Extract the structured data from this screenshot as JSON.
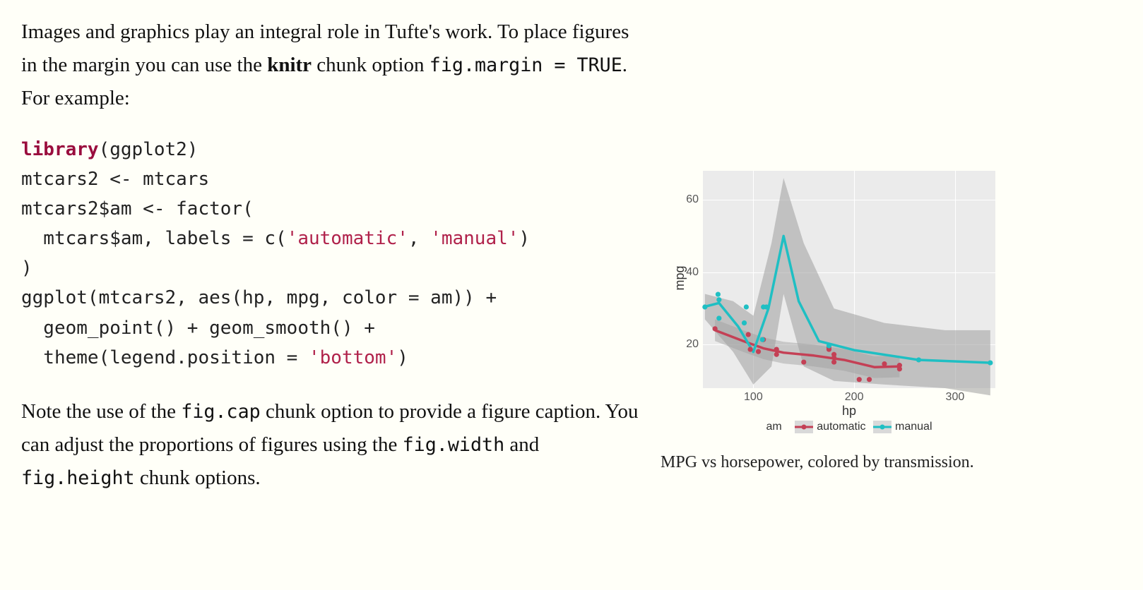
{
  "body": {
    "para1_a": "Images and graphics play an integral role in Tufte's work. To place figures in the margin you can use the ",
    "para1_strong": "knitr",
    "para1_b": " chunk option ",
    "para1_code": "fig.margin = TRUE",
    "para1_c": ". For example:",
    "para2_a": "Note the use of the ",
    "para2_code1": "fig.cap",
    "para2_b": " chunk option to provide a figure caption. You can adjust the proportions of figures using the ",
    "para2_code2": "fig.width",
    "para2_c": " and ",
    "para2_code3": "fig.height",
    "para2_d": " chunk options."
  },
  "code": {
    "kw_library": "library",
    "l1_rest": "(ggplot2)",
    "l2": "mtcars2 <- mtcars",
    "l3": "mtcars2$am <- factor(",
    "l4a": "  mtcars$am, labels = c(",
    "l4s1": "'automatic'",
    "l4b": ", ",
    "l4s2": "'manual'",
    "l4c": ")",
    "l5": ")",
    "l6": "ggplot(mtcars2, aes(hp, mpg, color = am)) +",
    "l7": "  geom_point() + geom_smooth() +",
    "l8a": "  theme(legend.position = ",
    "l8s": "'bottom'",
    "l8b": ")"
  },
  "margin": {
    "caption": "MPG vs horsepower, colored by transmission."
  },
  "chart_data": {
    "type": "line",
    "xlabel": "hp",
    "ylabel": "mpg",
    "xlim": [
      50,
      340
    ],
    "ylim": [
      8,
      68
    ],
    "x_ticks": [
      100,
      200,
      300
    ],
    "y_ticks": [
      20,
      40,
      60
    ],
    "legend": {
      "title": "am",
      "position": "bottom",
      "entries": [
        "automatic",
        "manual"
      ]
    },
    "series": [
      {
        "name": "automatic",
        "color": "#c44055",
        "points": [
          {
            "x": 62,
            "y": 24.4
          },
          {
            "x": 95,
            "y": 22.8
          },
          {
            "x": 97,
            "y": 18.7
          },
          {
            "x": 105,
            "y": 18.1
          },
          {
            "x": 110,
            "y": 21.4
          },
          {
            "x": 123,
            "y": 18.7
          },
          {
            "x": 123,
            "y": 17.3
          },
          {
            "x": 150,
            "y": 15.2
          },
          {
            "x": 175,
            "y": 18.7
          },
          {
            "x": 175,
            "y": 19.2
          },
          {
            "x": 180,
            "y": 16.4
          },
          {
            "x": 180,
            "y": 17.3
          },
          {
            "x": 180,
            "y": 15.2
          },
          {
            "x": 205,
            "y": 10.4
          },
          {
            "x": 215,
            "y": 10.4
          },
          {
            "x": 230,
            "y": 14.7
          },
          {
            "x": 245,
            "y": 14.3
          },
          {
            "x": 245,
            "y": 13.3
          }
        ],
        "smooth": [
          {
            "x": 62,
            "y": 24.0
          },
          {
            "x": 90,
            "y": 21.0
          },
          {
            "x": 110,
            "y": 19.0
          },
          {
            "x": 130,
            "y": 17.8
          },
          {
            "x": 160,
            "y": 17.0
          },
          {
            "x": 190,
            "y": 15.8
          },
          {
            "x": 220,
            "y": 13.8
          },
          {
            "x": 245,
            "y": 14.0
          }
        ]
      },
      {
        "name": "manual",
        "color": "#1fbfc3",
        "points": [
          {
            "x": 52,
            "y": 30.4
          },
          {
            "x": 65,
            "y": 33.9
          },
          {
            "x": 66,
            "y": 32.4
          },
          {
            "x": 66,
            "y": 27.3
          },
          {
            "x": 91,
            "y": 26.0
          },
          {
            "x": 93,
            "y": 30.4
          },
          {
            "x": 109,
            "y": 21.4
          },
          {
            "x": 110,
            "y": 30.4
          },
          {
            "x": 113,
            "y": 30.4
          },
          {
            "x": 175,
            "y": 19.7
          },
          {
            "x": 264,
            "y": 15.8
          },
          {
            "x": 335,
            "y": 15.0
          }
        ],
        "smooth": [
          {
            "x": 52,
            "y": 30.5
          },
          {
            "x": 66,
            "y": 31.5
          },
          {
            "x": 85,
            "y": 25.0
          },
          {
            "x": 100,
            "y": 18.0
          },
          {
            "x": 115,
            "y": 30.0
          },
          {
            "x": 130,
            "y": 50.0
          },
          {
            "x": 145,
            "y": 32.0
          },
          {
            "x": 165,
            "y": 21.0
          },
          {
            "x": 200,
            "y": 18.5
          },
          {
            "x": 264,
            "y": 15.8
          },
          {
            "x": 335,
            "y": 15.0
          }
        ],
        "ribbon_upper": [
          {
            "x": 52,
            "y": 34
          },
          {
            "x": 80,
            "y": 32
          },
          {
            "x": 100,
            "y": 28
          },
          {
            "x": 118,
            "y": 48
          },
          {
            "x": 130,
            "y": 66
          },
          {
            "x": 150,
            "y": 48
          },
          {
            "x": 180,
            "y": 30
          },
          {
            "x": 230,
            "y": 26
          },
          {
            "x": 290,
            "y": 24
          },
          {
            "x": 335,
            "y": 24
          }
        ],
        "ribbon_lower": [
          {
            "x": 335,
            "y": 6
          },
          {
            "x": 290,
            "y": 8
          },
          {
            "x": 230,
            "y": 9
          },
          {
            "x": 180,
            "y": 10
          },
          {
            "x": 150,
            "y": 14
          },
          {
            "x": 130,
            "y": 34
          },
          {
            "x": 118,
            "y": 14
          },
          {
            "x": 100,
            "y": 9
          },
          {
            "x": 80,
            "y": 18
          },
          {
            "x": 52,
            "y": 27
          }
        ]
      }
    ]
  }
}
